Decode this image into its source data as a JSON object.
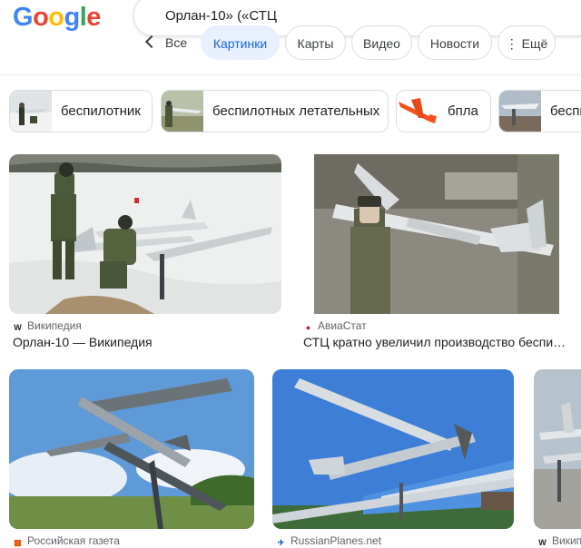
{
  "header": {
    "logo": [
      "G",
      "o",
      "o",
      "g",
      "l",
      "e"
    ],
    "logo_colors": [
      "#4285f4",
      "#ea4335",
      "#fbbc05",
      "#4285f4",
      "#34a853",
      "#ea4335"
    ],
    "query": "Орлан-10» («СТЦ"
  },
  "tabs": {
    "back": "Все",
    "items": [
      "Картинки",
      "Карты",
      "Видео",
      "Новости",
      "⋮ Ещё"
    ]
  },
  "chips": [
    "беспилотник",
    "беспилотных летательных",
    "бпла",
    "беспилот"
  ],
  "results": [
    {
      "source": "Википедия",
      "source_icon": "W",
      "caption": "Орлан-10 — Википедия"
    },
    {
      "source": "АвиаСтат",
      "source_icon": "●",
      "caption": "СТЦ кратно увеличил производство беспилотников"
    },
    {
      "source": "Российская газета",
      "source_icon": "▦",
      "caption": ""
    },
    {
      "source": "RussianPlanes.net",
      "source_icon": "✈",
      "caption": ""
    },
    {
      "source": "Википедия",
      "source_icon": "W",
      "caption": ""
    }
  ],
  "colors": {
    "accent": "#1967d2",
    "active_tab_bg": "#e8f0fe"
  }
}
